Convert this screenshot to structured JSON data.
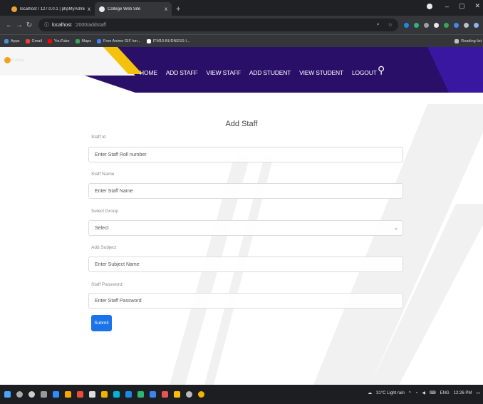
{
  "browser": {
    "tabs": [
      {
        "label": "localhost / 127.0.0.1 | phpMyAdmin"
      },
      {
        "label": "College Web Site"
      }
    ],
    "tab_close": "x",
    "new_tab": "+",
    "address": {
      "host": "localhost",
      "path": ":2000/addstaff"
    },
    "bookmarks": [
      {
        "label": "Apps",
        "color": "#4a90d9"
      },
      {
        "label": "Gmail",
        "color": "#ea4335"
      },
      {
        "label": "YouTube",
        "color": "#ff0000"
      },
      {
        "label": "Maps",
        "color": "#34a853"
      },
      {
        "label": "Free Anime GIF Ion...",
        "color": "#3c82f6"
      },
      {
        "label": "ITM10-BUDNESS-I...",
        "color": "#ffffff"
      }
    ],
    "reading_list": "Reading list"
  },
  "nav": {
    "logo_text": "College",
    "items": [
      "HOME",
      "ADD STAFF",
      "VIEW STAFF",
      "ADD STUDENT",
      "VIEW STUDENT",
      "LOGOUT"
    ]
  },
  "form": {
    "title": "Add Staff",
    "fields": [
      {
        "label": "Staff Id",
        "placeholder": "Enter Staff Roll number"
      },
      {
        "label": "Staff Name",
        "placeholder": "Enter Staff Name"
      },
      {
        "label": "Select Group",
        "placeholder": "Select"
      },
      {
        "label": "Add Subject",
        "placeholder": "Enter Subject Name"
      },
      {
        "label": "Staff Password",
        "placeholder": "Enter Staff Password"
      }
    ],
    "submit_label": "Submit"
  },
  "taskbar": {
    "weather": "31°C Light rain",
    "lang": "ENG",
    "time": "12:26 PM"
  },
  "colors": {
    "accent": "#1a73e8",
    "nav_bg": "#2a0f68",
    "nav_yellow": "#f4c20d"
  }
}
